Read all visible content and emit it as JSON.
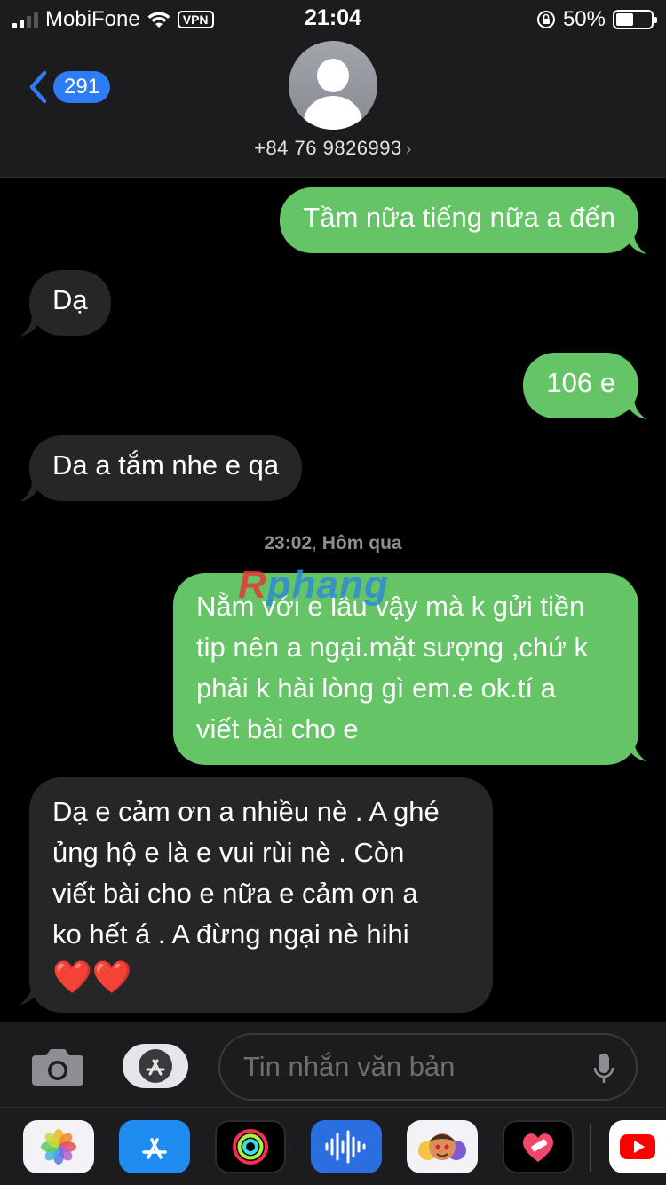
{
  "status_bar": {
    "carrier": "MobiFone",
    "vpn": "VPN",
    "time": "21:04",
    "battery": "50%",
    "battery_level": 0.5
  },
  "header": {
    "back_count": "291",
    "contact": "+84 76 9826993",
    "chevron": "›"
  },
  "messages": [
    {
      "dir": "out",
      "text": "Tầm nữa tiếng nữa a đến"
    },
    {
      "dir": "in",
      "text": "Dạ"
    },
    {
      "dir": "out",
      "text": "106 e"
    },
    {
      "dir": "in",
      "text": "Da a tắm nhe e qa"
    },
    {
      "dir": "out",
      "lines": [
        "Nằm với e lâu vậy mà k gửi tiền",
        "tip nên a ngại.mặt sượng ,chứ k",
        "phải k hài lòng gì em.e ok.tí a",
        "viết bài cho e"
      ]
    },
    {
      "dir": "in",
      "lines": [
        "Dạ e cảm ơn a nhiều nè . A ghé",
        "ủng hộ e là e vui rùi nè . Còn",
        "viết bài cho e nữa e cảm ơn a",
        "ko hết á . A đừng ngại nè hihi"
      ],
      "emoji": "❤️❤️"
    }
  ],
  "timestamp": {
    "time": "23:02",
    "day": "Hôm qua"
  },
  "watermark": {
    "first": "R",
    "rest": "phang"
  },
  "input": {
    "placeholder": "Tin nhắn văn bản"
  },
  "drawer_apps": [
    "photos-icon",
    "app-store-icon",
    "fitness-icon",
    "audio-waveform-icon",
    "memoji-icon",
    "heart-sticker-icon",
    "youtube-icon"
  ],
  "colors": {
    "outgoing": "#65c466",
    "incoming": "#262628",
    "badge": "#2d7cf6"
  }
}
